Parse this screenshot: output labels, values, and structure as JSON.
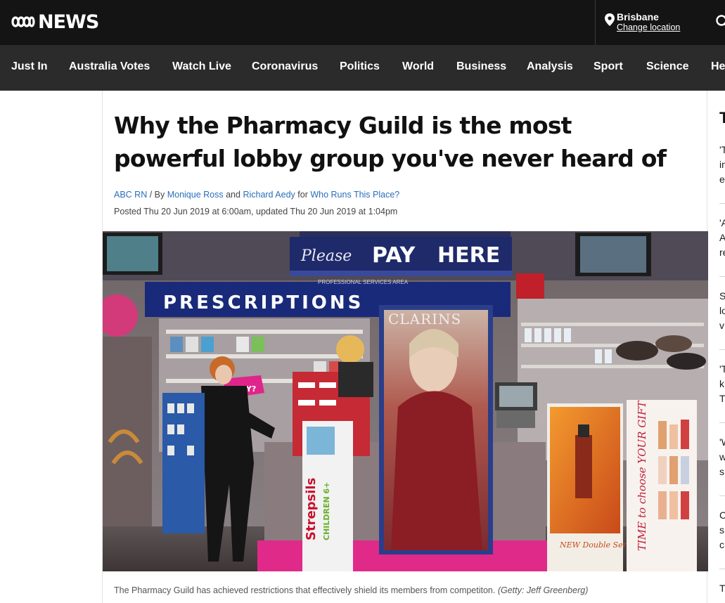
{
  "brand": {
    "logo_text": "NEWS"
  },
  "location": {
    "city": "Brisbane",
    "change_label": "Change location"
  },
  "nav": {
    "items": [
      "Just In",
      "Australia Votes",
      "Watch Live",
      "Coronavirus",
      "Politics",
      "World",
      "Business",
      "Analysis",
      "Sport",
      "Science",
      "He"
    ]
  },
  "article": {
    "headline": "Why the Pharmacy Guild is the most powerful lobby group you've never heard of",
    "byline": {
      "program": "ABC RN",
      "sep": " / By ",
      "author1": "Monique Ross",
      "and": " and ",
      "author2": "Richard Aedy",
      "for": " for ",
      "show": "Who Runs This Place?"
    },
    "dateline": "Posted Thu 20 Jun 2019 at 6:00am, updated Thu 20 Jun 2019 at 1:04pm",
    "image": {
      "signs": {
        "please": "Please",
        "pay": "PAY",
        "here": "HERE",
        "prescriptions": "PRESCRIPTIONS",
        "clarins": "CLARINS",
        "professional": "PROFESSIONAL SERVICES AREA",
        "strepsils": "Strepsils",
        "children": "CHILDREN 6+",
        "choose": "TIME to choose YOUR GIFT",
        "serum": "NEW Double Serum",
        "thirsty": "RSTY?"
      }
    },
    "caption": "The Pharmacy Guild has achieved restrictions that effectively shield its members from competiton.",
    "credit": "(Getty: Jeff Greenberg)"
  },
  "sidebar": {
    "heading": "T",
    "items": [
      [
        "'T",
        "in",
        "e"
      ],
      [
        "'A",
        "A",
        "re"
      ],
      [
        "S",
        "lo",
        "v"
      ],
      [
        "'T",
        "k",
        "T"
      ],
      [
        "'W",
        "w",
        "s"
      ],
      [
        "C",
        "s",
        "c"
      ],
      [
        "T"
      ]
    ]
  },
  "colors": {
    "topbar": "#141414",
    "nav": "#2b2b2b",
    "link": "#2a6ebb"
  }
}
